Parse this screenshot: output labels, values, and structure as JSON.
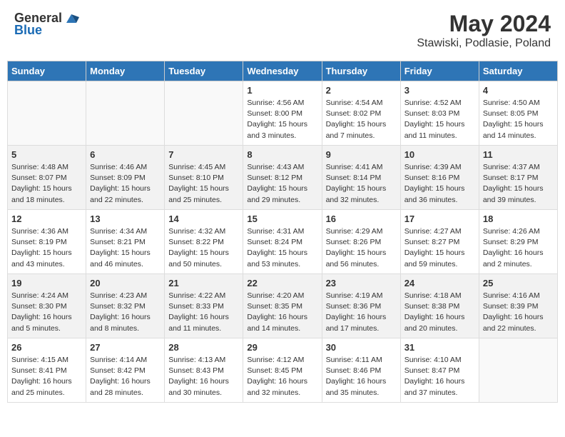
{
  "header": {
    "logo_general": "General",
    "logo_blue": "Blue",
    "month_title": "May 2024",
    "location": "Stawiski, Podlasie, Poland"
  },
  "days_of_week": [
    "Sunday",
    "Monday",
    "Tuesday",
    "Wednesday",
    "Thursday",
    "Friday",
    "Saturday"
  ],
  "weeks": [
    [
      {
        "day": "",
        "info": ""
      },
      {
        "day": "",
        "info": ""
      },
      {
        "day": "",
        "info": ""
      },
      {
        "day": "1",
        "info": "Sunrise: 4:56 AM\nSunset: 8:00 PM\nDaylight: 15 hours\nand 3 minutes."
      },
      {
        "day": "2",
        "info": "Sunrise: 4:54 AM\nSunset: 8:02 PM\nDaylight: 15 hours\nand 7 minutes."
      },
      {
        "day": "3",
        "info": "Sunrise: 4:52 AM\nSunset: 8:03 PM\nDaylight: 15 hours\nand 11 minutes."
      },
      {
        "day": "4",
        "info": "Sunrise: 4:50 AM\nSunset: 8:05 PM\nDaylight: 15 hours\nand 14 minutes."
      }
    ],
    [
      {
        "day": "5",
        "info": "Sunrise: 4:48 AM\nSunset: 8:07 PM\nDaylight: 15 hours\nand 18 minutes."
      },
      {
        "day": "6",
        "info": "Sunrise: 4:46 AM\nSunset: 8:09 PM\nDaylight: 15 hours\nand 22 minutes."
      },
      {
        "day": "7",
        "info": "Sunrise: 4:45 AM\nSunset: 8:10 PM\nDaylight: 15 hours\nand 25 minutes."
      },
      {
        "day": "8",
        "info": "Sunrise: 4:43 AM\nSunset: 8:12 PM\nDaylight: 15 hours\nand 29 minutes."
      },
      {
        "day": "9",
        "info": "Sunrise: 4:41 AM\nSunset: 8:14 PM\nDaylight: 15 hours\nand 32 minutes."
      },
      {
        "day": "10",
        "info": "Sunrise: 4:39 AM\nSunset: 8:16 PM\nDaylight: 15 hours\nand 36 minutes."
      },
      {
        "day": "11",
        "info": "Sunrise: 4:37 AM\nSunset: 8:17 PM\nDaylight: 15 hours\nand 39 minutes."
      }
    ],
    [
      {
        "day": "12",
        "info": "Sunrise: 4:36 AM\nSunset: 8:19 PM\nDaylight: 15 hours\nand 43 minutes."
      },
      {
        "day": "13",
        "info": "Sunrise: 4:34 AM\nSunset: 8:21 PM\nDaylight: 15 hours\nand 46 minutes."
      },
      {
        "day": "14",
        "info": "Sunrise: 4:32 AM\nSunset: 8:22 PM\nDaylight: 15 hours\nand 50 minutes."
      },
      {
        "day": "15",
        "info": "Sunrise: 4:31 AM\nSunset: 8:24 PM\nDaylight: 15 hours\nand 53 minutes."
      },
      {
        "day": "16",
        "info": "Sunrise: 4:29 AM\nSunset: 8:26 PM\nDaylight: 15 hours\nand 56 minutes."
      },
      {
        "day": "17",
        "info": "Sunrise: 4:27 AM\nSunset: 8:27 PM\nDaylight: 15 hours\nand 59 minutes."
      },
      {
        "day": "18",
        "info": "Sunrise: 4:26 AM\nSunset: 8:29 PM\nDaylight: 16 hours\nand 2 minutes."
      }
    ],
    [
      {
        "day": "19",
        "info": "Sunrise: 4:24 AM\nSunset: 8:30 PM\nDaylight: 16 hours\nand 5 minutes."
      },
      {
        "day": "20",
        "info": "Sunrise: 4:23 AM\nSunset: 8:32 PM\nDaylight: 16 hours\nand 8 minutes."
      },
      {
        "day": "21",
        "info": "Sunrise: 4:22 AM\nSunset: 8:33 PM\nDaylight: 16 hours\nand 11 minutes."
      },
      {
        "day": "22",
        "info": "Sunrise: 4:20 AM\nSunset: 8:35 PM\nDaylight: 16 hours\nand 14 minutes."
      },
      {
        "day": "23",
        "info": "Sunrise: 4:19 AM\nSunset: 8:36 PM\nDaylight: 16 hours\nand 17 minutes."
      },
      {
        "day": "24",
        "info": "Sunrise: 4:18 AM\nSunset: 8:38 PM\nDaylight: 16 hours\nand 20 minutes."
      },
      {
        "day": "25",
        "info": "Sunrise: 4:16 AM\nSunset: 8:39 PM\nDaylight: 16 hours\nand 22 minutes."
      }
    ],
    [
      {
        "day": "26",
        "info": "Sunrise: 4:15 AM\nSunset: 8:41 PM\nDaylight: 16 hours\nand 25 minutes."
      },
      {
        "day": "27",
        "info": "Sunrise: 4:14 AM\nSunset: 8:42 PM\nDaylight: 16 hours\nand 28 minutes."
      },
      {
        "day": "28",
        "info": "Sunrise: 4:13 AM\nSunset: 8:43 PM\nDaylight: 16 hours\nand 30 minutes."
      },
      {
        "day": "29",
        "info": "Sunrise: 4:12 AM\nSunset: 8:45 PM\nDaylight: 16 hours\nand 32 minutes."
      },
      {
        "day": "30",
        "info": "Sunrise: 4:11 AM\nSunset: 8:46 PM\nDaylight: 16 hours\nand 35 minutes."
      },
      {
        "day": "31",
        "info": "Sunrise: 4:10 AM\nSunset: 8:47 PM\nDaylight: 16 hours\nand 37 minutes."
      },
      {
        "day": "",
        "info": ""
      }
    ]
  ]
}
